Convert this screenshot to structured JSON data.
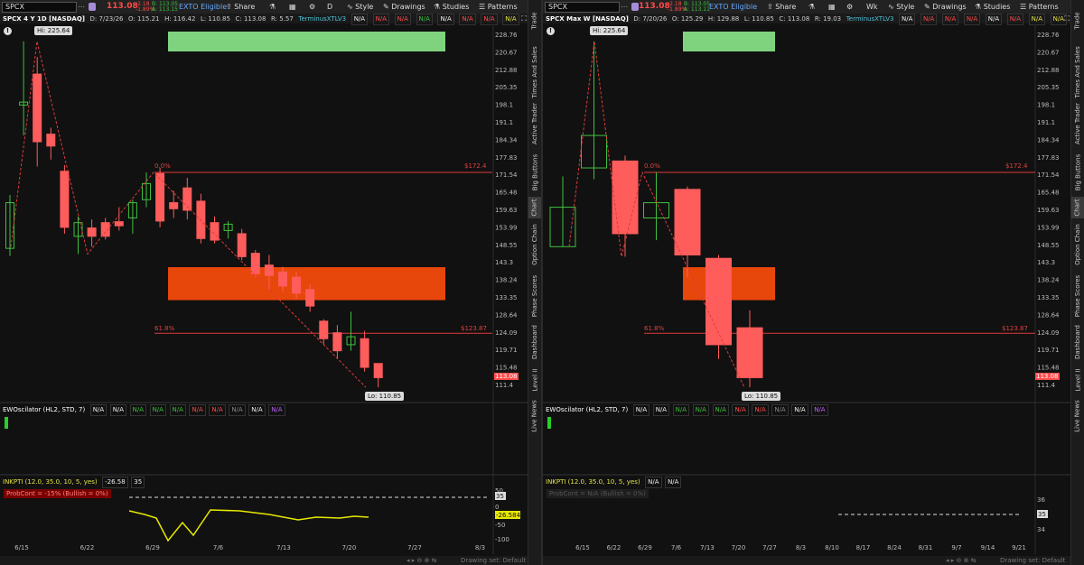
{
  "colors": {
    "up": "#3fc03f",
    "down": "#ff5c5c",
    "fib": "#e03a3a",
    "supply": "#7fd37f",
    "demand": "#ff4e0b",
    "ao": "#e8e800"
  },
  "panels": [
    {
      "symbol": "SPCX",
      "price": "113.08",
      "change": [
        "-2.18",
        "-1.89%"
      ],
      "bidask": [
        "B: 113.05",
        "A: 113.15"
      ],
      "interval": "D",
      "title": "SPCX 4 Y 1D [NASDAQ]",
      "ohlc": [
        "D: 7/23/26",
        "O: 115.21",
        "H: 116.42",
        "L: 110.85",
        "C: 113.08",
        "R: 5.57"
      ],
      "terminus": "TerminusXTLV3",
      "na_count": 8,
      "hi_label": "Hi: 225.64",
      "lo_label": "Lo: 110.85",
      "fib_top_pct": "0.0%",
      "fib_top_val": "$172.4",
      "fib_mid_pct": "61.8%",
      "fib_mid_val": "$123.87",
      "price_ticks": [
        "228.76",
        "220.67",
        "212.88",
        "205.35",
        "198.1",
        "191.1",
        "184.34",
        "177.83",
        "171.54",
        "165.48",
        "159.63",
        "153.99",
        "148.55",
        "143.3",
        "138.24",
        "133.35",
        "128.64",
        "124.09",
        "119.71",
        "115.48",
        "111.4"
      ],
      "last_price_tag": "113.08",
      "ewo_title": "EWOscilator (HL2, STD, 7)",
      "ewo_values": [
        "N/A",
        "N/A",
        "N/A",
        "N/A",
        "N/A",
        "N/A",
        "N/A",
        "N/A",
        "N/A",
        "N/A"
      ],
      "ewo_axis": "",
      "inkpti_title": "INKPTI (12.0, 35.0, 10, 5, yes)",
      "inkpti_values": [
        "-26.58",
        "35"
      ],
      "prob_label": "ProbCont = -15% (Bullish = 0%)",
      "ao_ticks": [
        "50",
        "35",
        "0",
        "-26.584",
        "-50",
        "-100"
      ],
      "x_labels": [
        "6/15",
        "6/22",
        "6/29",
        "7/6",
        "7/13",
        "7/20",
        "7/27",
        "8/3"
      ],
      "status_text": "Drawing set: Default"
    },
    {
      "symbol": "SPCX",
      "price": "113.08",
      "change": [
        "-2.18",
        "-1.89%"
      ],
      "bidask": [
        "B: 113.05",
        "A: 113.11"
      ],
      "interval": "Wk",
      "title": "SPCX Max W [NASDAQ]",
      "ohlc": [
        "D: 7/20/26",
        "O: 125.29",
        "H: 129.88",
        "L: 110.85",
        "C: 113.08",
        "R: 19.03"
      ],
      "terminus": "TerminusXTLV3",
      "na_count": 8,
      "hi_label": "Hi: 225.64",
      "lo_label": "Lo: 110.85",
      "fib_top_pct": "0.0%",
      "fib_top_val": "$172.4",
      "fib_mid_pct": "61.8%",
      "fib_mid_val": "$123.87",
      "price_ticks": [
        "228.76",
        "220.67",
        "212.88",
        "205.35",
        "198.1",
        "191.1",
        "184.34",
        "177.83",
        "171.54",
        "165.48",
        "159.63",
        "153.99",
        "148.55",
        "143.3",
        "138.24",
        "133.35",
        "128.64",
        "124.09",
        "119.71",
        "115.48",
        "111.4"
      ],
      "last_price_tag": "113.08",
      "ewo_title": "EWOscilator (HL2, STD, 7)",
      "ewo_values": [
        "N/A",
        "N/A",
        "N/A",
        "N/A",
        "N/A",
        "N/A",
        "N/A",
        "N/A",
        "N/A",
        "N/A"
      ],
      "ewo_axis": "",
      "inkpti_title": "INKPTI (12.0, 35.0, 10, 5, yes)",
      "inkpti_values": [
        "N/A",
        "N/A"
      ],
      "prob_label": "ProbCont = N/A (Bullish = 0%)",
      "ao_ticks": [
        "36",
        "35",
        "34"
      ],
      "x_labels": [
        "6/15",
        "6/22",
        "6/29",
        "7/6",
        "7/13",
        "7/20",
        "7/27",
        "8/3",
        "8/10",
        "8/17",
        "8/24",
        "8/31",
        "9/7",
        "9/14",
        "9/21"
      ],
      "status_text": "Drawing set: Default"
    }
  ],
  "toolbar": {
    "exto": "EXTO Eligible",
    "share": "Share",
    "style": "Style",
    "drawings": "Drawings",
    "studies": "Studies",
    "patterns": "Patterns"
  },
  "sidebar": [
    "Trade",
    "Times And Sales",
    "Active Trader",
    "Big Buttons",
    "Chart",
    "Option Chain",
    "Phase Scores",
    "Dashboard",
    "Level II",
    "Live News"
  ],
  "chart_data": [
    {
      "type": "candlestick",
      "title": "SPCX 4 Y 1D [NASDAQ]",
      "candles": [
        {
          "o": 147.5,
          "h": 164.6,
          "l": 145.2,
          "c": 162.0
        },
        {
          "o": 198.0,
          "h": 225.64,
          "l": 186.0,
          "c": 199.2
        },
        {
          "o": 211.0,
          "h": 218.5,
          "l": 174.5,
          "c": 183.6
        },
        {
          "o": 186.5,
          "h": 189.0,
          "l": 177.0,
          "c": 182.0
        },
        {
          "o": 172.8,
          "h": 175.0,
          "l": 152.0,
          "c": 154.0
        },
        {
          "o": 151.2,
          "h": 157.5,
          "l": 145.8,
          "c": 155.5
        },
        {
          "o": 153.8,
          "h": 156.5,
          "l": 148.0,
          "c": 151.2
        },
        {
          "o": 155.5,
          "h": 157.0,
          "l": 150.2,
          "c": 151.2
        },
        {
          "o": 155.8,
          "h": 160.5,
          "l": 153.0,
          "c": 154.5
        },
        {
          "o": 157.0,
          "h": 163.0,
          "l": 152.0,
          "c": 162.0
        },
        {
          "o": 163.0,
          "h": 172.4,
          "l": 160.5,
          "c": 168.5
        },
        {
          "o": 172.0,
          "h": 174.0,
          "l": 154.0,
          "c": 156.0
        },
        {
          "o": 162.0,
          "h": 166.0,
          "l": 157.0,
          "c": 160.0
        },
        {
          "o": 167.0,
          "h": 170.5,
          "l": 156.5,
          "c": 159.5
        },
        {
          "o": 162.5,
          "h": 165.0,
          "l": 149.0,
          "c": 150.5
        },
        {
          "o": 155.5,
          "h": 157.5,
          "l": 149.0,
          "c": 150.0
        },
        {
          "o": 153.0,
          "h": 156.0,
          "l": 150.5,
          "c": 155.0
        },
        {
          "o": 152.0,
          "h": 153.5,
          "l": 144.0,
          "c": 145.0
        },
        {
          "o": 146.0,
          "h": 147.0,
          "l": 139.0,
          "c": 140.0
        },
        {
          "o": 142.5,
          "h": 145.5,
          "l": 135.5,
          "c": 139.5
        },
        {
          "o": 140.5,
          "h": 142.0,
          "l": 135.0,
          "c": 136.5
        },
        {
          "o": 139.0,
          "h": 140.5,
          "l": 133.0,
          "c": 134.5
        },
        {
          "o": 135.5,
          "h": 137.0,
          "l": 129.5,
          "c": 131.0
        },
        {
          "o": 127.0,
          "h": 127.5,
          "l": 121.0,
          "c": 122.5
        },
        {
          "o": 124.0,
          "h": 126.0,
          "l": 117.5,
          "c": 119.5
        },
        {
          "o": 121.0,
          "h": 129.5,
          "l": 119.5,
          "c": 123.0
        },
        {
          "o": 122.5,
          "h": 124.5,
          "l": 114.5,
          "c": 115.5
        },
        {
          "o": 116.42,
          "h": 116.42,
          "l": 110.85,
          "c": 113.08
        }
      ],
      "ylim": [
        110.0,
        228.76
      ]
    },
    {
      "type": "candlestick",
      "title": "SPCX Max W [NASDAQ]",
      "candles": [
        {
          "o": 148.0,
          "h": 171.0,
          "l": 148.0,
          "c": 160.5
        },
        {
          "o": 174.0,
          "h": 225.64,
          "l": 170.0,
          "c": 186.0
        },
        {
          "o": 176.5,
          "h": 178.5,
          "l": 145.0,
          "c": 152.0
        },
        {
          "o": 157.0,
          "h": 172.4,
          "l": 150.0,
          "c": 162.0
        },
        {
          "o": 166.5,
          "h": 167.5,
          "l": 139.0,
          "c": 145.5
        },
        {
          "o": 144.5,
          "h": 145.5,
          "l": 117.5,
          "c": 121.0
        },
        {
          "o": 125.29,
          "h": 129.88,
          "l": 110.85,
          "c": 113.08
        }
      ],
      "ylim": [
        110.0,
        228.76
      ]
    }
  ]
}
